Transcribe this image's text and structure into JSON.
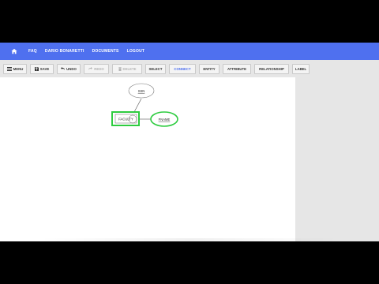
{
  "navbar": {
    "home_icon": "home-icon",
    "links": [
      "FAQ",
      "DARIO BONARETTI",
      "DOCUMENTS",
      "LOGOUT"
    ]
  },
  "toolbar": {
    "menu": "MENU",
    "save": "SAVE",
    "undo": "UNDO",
    "redo": "REDO",
    "delete": "DELETE",
    "select": "SELECT",
    "connect": "CONNECT",
    "entity": "ENTITY",
    "attribute": "ATTRIBUTE",
    "relationship": "RELATIONSHIP",
    "label": "LABEL"
  },
  "diagram": {
    "entity": "FACULTY",
    "attr_top": "SSN",
    "attr_right": "FNAME"
  },
  "colors": {
    "accent": "#4f70ef",
    "selection": "#2ecc40"
  }
}
